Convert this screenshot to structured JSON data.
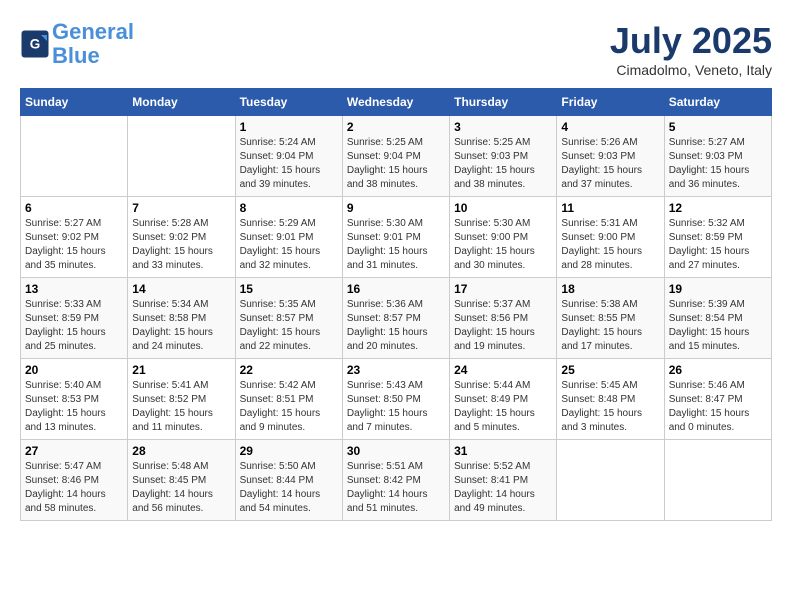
{
  "header": {
    "logo_line1": "General",
    "logo_line2": "Blue",
    "month_title": "July 2025",
    "subtitle": "Cimadolmo, Veneto, Italy"
  },
  "weekdays": [
    "Sunday",
    "Monday",
    "Tuesday",
    "Wednesday",
    "Thursday",
    "Friday",
    "Saturday"
  ],
  "weeks": [
    [
      {
        "day": "",
        "info": ""
      },
      {
        "day": "",
        "info": ""
      },
      {
        "day": "1",
        "info": "Sunrise: 5:24 AM\nSunset: 9:04 PM\nDaylight: 15 hours\nand 39 minutes."
      },
      {
        "day": "2",
        "info": "Sunrise: 5:25 AM\nSunset: 9:04 PM\nDaylight: 15 hours\nand 38 minutes."
      },
      {
        "day": "3",
        "info": "Sunrise: 5:25 AM\nSunset: 9:03 PM\nDaylight: 15 hours\nand 38 minutes."
      },
      {
        "day": "4",
        "info": "Sunrise: 5:26 AM\nSunset: 9:03 PM\nDaylight: 15 hours\nand 37 minutes."
      },
      {
        "day": "5",
        "info": "Sunrise: 5:27 AM\nSunset: 9:03 PM\nDaylight: 15 hours\nand 36 minutes."
      }
    ],
    [
      {
        "day": "6",
        "info": "Sunrise: 5:27 AM\nSunset: 9:02 PM\nDaylight: 15 hours\nand 35 minutes."
      },
      {
        "day": "7",
        "info": "Sunrise: 5:28 AM\nSunset: 9:02 PM\nDaylight: 15 hours\nand 33 minutes."
      },
      {
        "day": "8",
        "info": "Sunrise: 5:29 AM\nSunset: 9:01 PM\nDaylight: 15 hours\nand 32 minutes."
      },
      {
        "day": "9",
        "info": "Sunrise: 5:30 AM\nSunset: 9:01 PM\nDaylight: 15 hours\nand 31 minutes."
      },
      {
        "day": "10",
        "info": "Sunrise: 5:30 AM\nSunset: 9:00 PM\nDaylight: 15 hours\nand 30 minutes."
      },
      {
        "day": "11",
        "info": "Sunrise: 5:31 AM\nSunset: 9:00 PM\nDaylight: 15 hours\nand 28 minutes."
      },
      {
        "day": "12",
        "info": "Sunrise: 5:32 AM\nSunset: 8:59 PM\nDaylight: 15 hours\nand 27 minutes."
      }
    ],
    [
      {
        "day": "13",
        "info": "Sunrise: 5:33 AM\nSunset: 8:59 PM\nDaylight: 15 hours\nand 25 minutes."
      },
      {
        "day": "14",
        "info": "Sunrise: 5:34 AM\nSunset: 8:58 PM\nDaylight: 15 hours\nand 24 minutes."
      },
      {
        "day": "15",
        "info": "Sunrise: 5:35 AM\nSunset: 8:57 PM\nDaylight: 15 hours\nand 22 minutes."
      },
      {
        "day": "16",
        "info": "Sunrise: 5:36 AM\nSunset: 8:57 PM\nDaylight: 15 hours\nand 20 minutes."
      },
      {
        "day": "17",
        "info": "Sunrise: 5:37 AM\nSunset: 8:56 PM\nDaylight: 15 hours\nand 19 minutes."
      },
      {
        "day": "18",
        "info": "Sunrise: 5:38 AM\nSunset: 8:55 PM\nDaylight: 15 hours\nand 17 minutes."
      },
      {
        "day": "19",
        "info": "Sunrise: 5:39 AM\nSunset: 8:54 PM\nDaylight: 15 hours\nand 15 minutes."
      }
    ],
    [
      {
        "day": "20",
        "info": "Sunrise: 5:40 AM\nSunset: 8:53 PM\nDaylight: 15 hours\nand 13 minutes."
      },
      {
        "day": "21",
        "info": "Sunrise: 5:41 AM\nSunset: 8:52 PM\nDaylight: 15 hours\nand 11 minutes."
      },
      {
        "day": "22",
        "info": "Sunrise: 5:42 AM\nSunset: 8:51 PM\nDaylight: 15 hours\nand 9 minutes."
      },
      {
        "day": "23",
        "info": "Sunrise: 5:43 AM\nSunset: 8:50 PM\nDaylight: 15 hours\nand 7 minutes."
      },
      {
        "day": "24",
        "info": "Sunrise: 5:44 AM\nSunset: 8:49 PM\nDaylight: 15 hours\nand 5 minutes."
      },
      {
        "day": "25",
        "info": "Sunrise: 5:45 AM\nSunset: 8:48 PM\nDaylight: 15 hours\nand 3 minutes."
      },
      {
        "day": "26",
        "info": "Sunrise: 5:46 AM\nSunset: 8:47 PM\nDaylight: 15 hours\nand 0 minutes."
      }
    ],
    [
      {
        "day": "27",
        "info": "Sunrise: 5:47 AM\nSunset: 8:46 PM\nDaylight: 14 hours\nand 58 minutes."
      },
      {
        "day": "28",
        "info": "Sunrise: 5:48 AM\nSunset: 8:45 PM\nDaylight: 14 hours\nand 56 minutes."
      },
      {
        "day": "29",
        "info": "Sunrise: 5:50 AM\nSunset: 8:44 PM\nDaylight: 14 hours\nand 54 minutes."
      },
      {
        "day": "30",
        "info": "Sunrise: 5:51 AM\nSunset: 8:42 PM\nDaylight: 14 hours\nand 51 minutes."
      },
      {
        "day": "31",
        "info": "Sunrise: 5:52 AM\nSunset: 8:41 PM\nDaylight: 14 hours\nand 49 minutes."
      },
      {
        "day": "",
        "info": ""
      },
      {
        "day": "",
        "info": ""
      }
    ]
  ]
}
